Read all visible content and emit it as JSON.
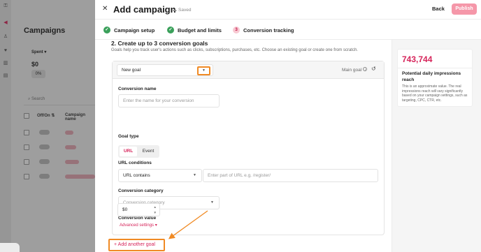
{
  "background_app": {
    "title": "Campaigns",
    "spent_label": "Spent ▾",
    "spent_value": "$0",
    "percent_badge": "0%",
    "search_placeholder": "Search",
    "columns": [
      "Off/On ⇅",
      "Campaign name"
    ]
  },
  "drawer": {
    "close_icon": "close-icon",
    "title": "Add campaign",
    "saved_status": "Saved",
    "back_label": "Back",
    "publish_label": "Publish",
    "steps": [
      {
        "label": "Campaign setup",
        "state": "done",
        "marker": "✓"
      },
      {
        "label": "Budget and limits",
        "state": "done",
        "marker": "✓"
      },
      {
        "label": "Conversion tracking",
        "state": "active",
        "marker": "3"
      }
    ],
    "section": {
      "title": "2. Create up to 3 conversion goals",
      "subtitle": "Goals help you track user's actions such as clicks, subscriptions, purchases, etc. Choose an existing goal or create one from scratch."
    },
    "goal": {
      "selected_goal": "New goal",
      "main_goal_label": "Main goal",
      "conversion_name_label": "Conversion name",
      "conversion_name_placeholder": "Enter the name for your conversion",
      "goal_type_label": "Goal type",
      "goal_type_options": [
        "URL",
        "Event"
      ],
      "goal_type_selected": "URL",
      "url_conditions_label": "URL conditions",
      "url_condition_value": "URL contains",
      "url_placeholder": "Enter part of URL e.g. /register/",
      "conversion_category_label": "Conversion category",
      "conversion_category_placeholder": "Conversion category",
      "conversion_value_label": "Conversion value",
      "conversion_value": "$0",
      "advanced_settings_label": "Advanced settings ▾"
    },
    "add_goal_label": "+ Add another goal",
    "estimate": {
      "value": "743,744",
      "title": "Potential daily impressions reach",
      "note": "This is an approximate value. The real impressions reach will vary significantly based on your campaign settings, such as targeting, CPC, CTR, etc."
    }
  },
  "colors": {
    "accent": "#d6245a",
    "publish_bg": "#f597a9",
    "success": "#3aa05a",
    "highlight": "#f08a24"
  }
}
